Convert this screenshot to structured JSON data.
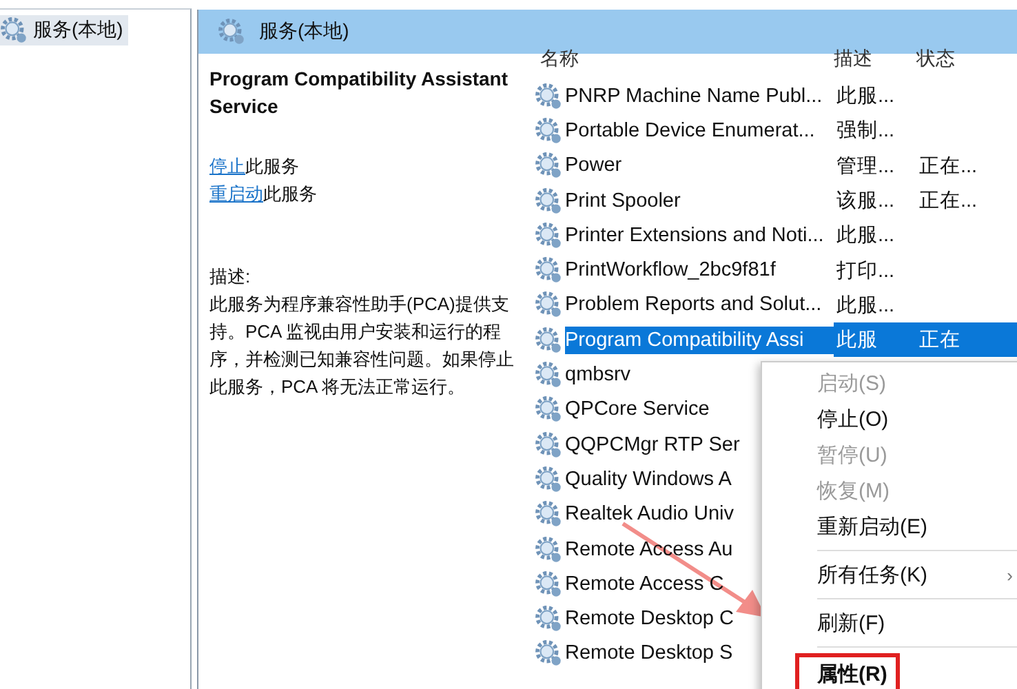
{
  "tree": {
    "items": [
      {
        "label": "服务(本地)",
        "selected": true
      }
    ]
  },
  "panel": {
    "title": "服务(本地)"
  },
  "details": {
    "service_name": "Program Compatibility Assistant Service",
    "actions": [
      {
        "link": "停止",
        "text": "此服务"
      },
      {
        "link": "重启动",
        "text": "此服务"
      }
    ],
    "description_label": "描述:",
    "description": "此服务为程序兼容性助手(PCA)提供支持。PCA 监视由用户安装和运行的程序，并检测已知兼容性问题。如果停止此服务，PCA 将无法正常运行。"
  },
  "table": {
    "columns": [
      "名称",
      "描述",
      "状态"
    ],
    "rows": [
      {
        "name": "PNRP Machine Name Publ...",
        "description": "此服...",
        "status": "",
        "selected": false
      },
      {
        "name": "Portable Device Enumerat...",
        "description": "强制...",
        "status": "",
        "selected": false
      },
      {
        "name": "Power",
        "description": "管理...",
        "status": "正在...",
        "selected": false
      },
      {
        "name": "Print Spooler",
        "description": "该服...",
        "status": "正在...",
        "selected": false
      },
      {
        "name": "Printer Extensions and Noti...",
        "description": "此服...",
        "status": "",
        "selected": false
      },
      {
        "name": "PrintWorkflow_2bc9f81f",
        "description": "打印...",
        "status": "",
        "selected": false
      },
      {
        "name": "Problem Reports and Solut...",
        "description": "此服...",
        "status": "",
        "selected": false
      },
      {
        "name": "Program Compatibility Assi",
        "description": "此服",
        "status": "正在",
        "selected": true
      },
      {
        "name": "qmbsrv",
        "description": "",
        "status": "",
        "selected": false
      },
      {
        "name": "QPCore Service",
        "description": "",
        "status": "",
        "selected": false
      },
      {
        "name": "QQPCMgr RTP Ser",
        "description": "",
        "status": "",
        "selected": false
      },
      {
        "name": "Quality Windows A",
        "description": "",
        "status": "",
        "selected": false
      },
      {
        "name": "Realtek Audio Univ",
        "description": "",
        "status": "",
        "selected": false
      },
      {
        "name": "Remote Access Au",
        "description": "",
        "status": "",
        "selected": false
      },
      {
        "name": "Remote Access C",
        "description": "",
        "status": "",
        "selected": false
      },
      {
        "name": "Remote Desktop C",
        "description": "",
        "status": "",
        "selected": false
      },
      {
        "name": "Remote Desktop S",
        "description": "",
        "status": "",
        "selected": false
      }
    ]
  },
  "context_menu": {
    "items": [
      {
        "kind": "item",
        "label": "启动(S)",
        "disabled": true,
        "highlighted": false
      },
      {
        "kind": "item",
        "label": "停止(O)",
        "disabled": false,
        "highlighted": false
      },
      {
        "kind": "item",
        "label": "暂停(U)",
        "disabled": true,
        "highlighted": false
      },
      {
        "kind": "item",
        "label": "恢复(M)",
        "disabled": true,
        "highlighted": false
      },
      {
        "kind": "item",
        "label": "重新启动(E)",
        "disabled": false,
        "highlighted": false
      },
      {
        "kind": "separator"
      },
      {
        "kind": "submenu",
        "label": "所有任务(K)",
        "arrow": "›",
        "disabled": false,
        "highlighted": false
      },
      {
        "kind": "separator"
      },
      {
        "kind": "item",
        "label": "刷新(F)",
        "disabled": false,
        "highlighted": false
      },
      {
        "kind": "separator"
      },
      {
        "kind": "item",
        "label": "属性(R)",
        "disabled": false,
        "highlighted": true
      }
    ]
  }
}
